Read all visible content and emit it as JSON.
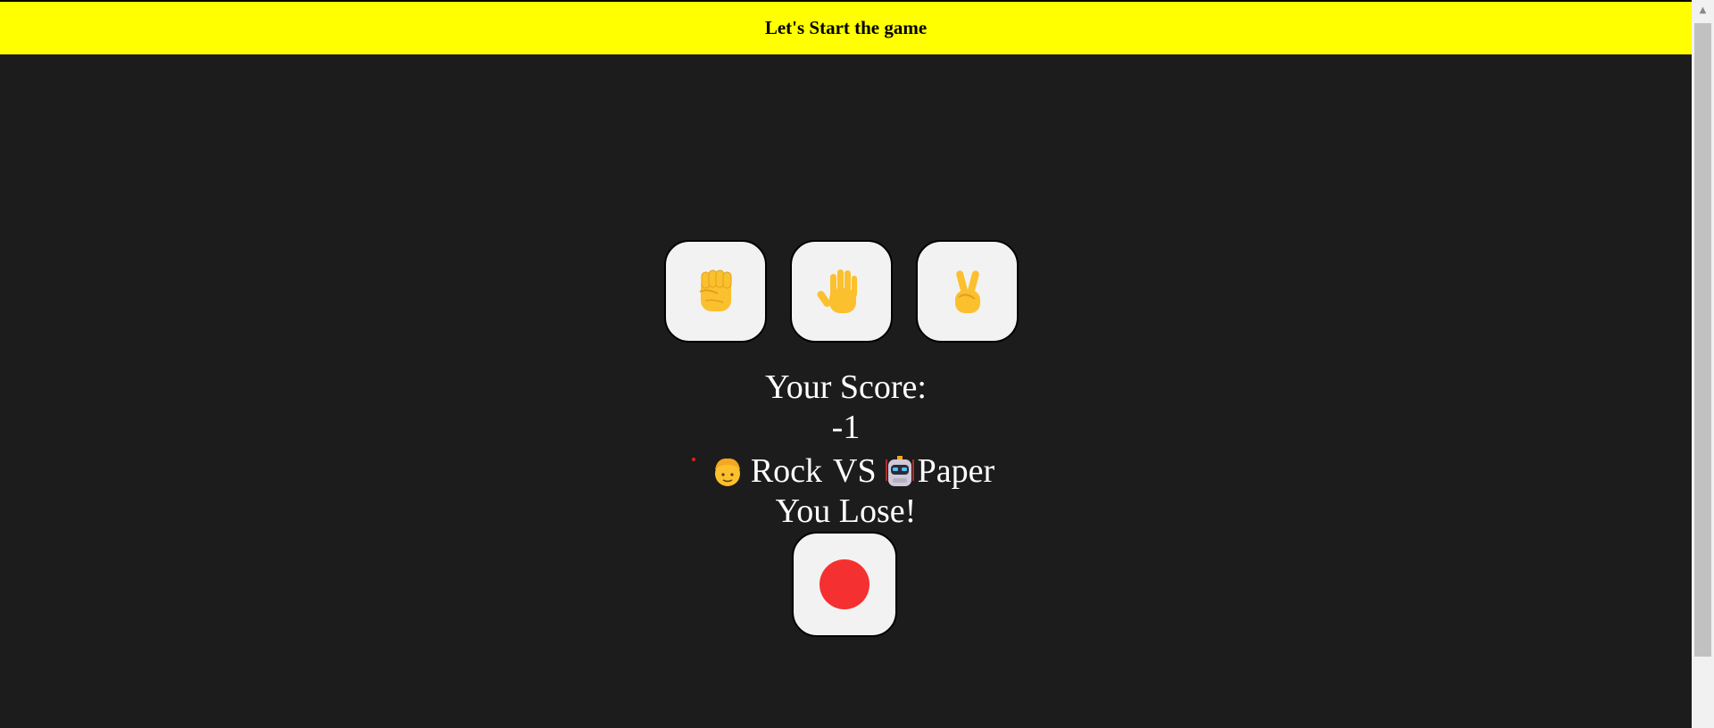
{
  "header": {
    "title": "Let's Start the game"
  },
  "choices": [
    {
      "name": "rock",
      "icon": "raised-fist-icon"
    },
    {
      "name": "paper",
      "icon": "raised-hand-icon"
    },
    {
      "name": "scissors",
      "icon": "victory-hand-icon"
    }
  ],
  "score": {
    "label": "Your Score:",
    "value": "-1"
  },
  "matchup": {
    "player_icon": "person-icon",
    "player_choice": "Rock",
    "vs": "VS",
    "computer_icon": "robot-icon",
    "computer_choice": "Paper"
  },
  "result": "You Lose!",
  "record_button": {
    "icon": "record-dot-icon",
    "color": "#f53030"
  },
  "colors": {
    "header_bg": "#ffff00",
    "page_bg": "#1c1c1c",
    "button_bg": "#f2f2f2",
    "emoji_yellow": "#fbc02d"
  }
}
